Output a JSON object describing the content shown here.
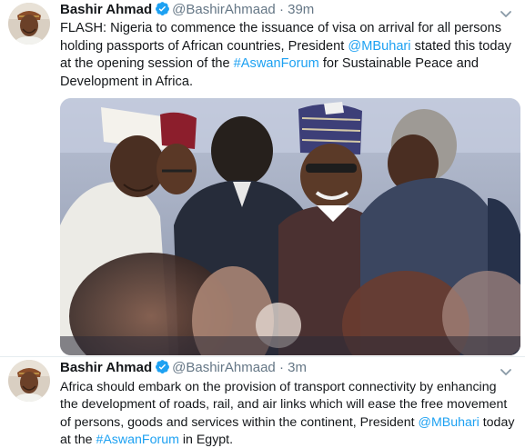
{
  "tweets": [
    {
      "author": {
        "name": "Bashir Ahmad",
        "handle": "@BashirAhmaad",
        "verified": true
      },
      "separator": "·",
      "time": "39m",
      "text": {
        "part1": "FLASH: Nigeria to commence the issuance of visa on arrival for all persons holding passports of African countries, President ",
        "mention": "@MBuhari",
        "part2": " stated this today at the opening session of the ",
        "hashtag": "#AswanForum",
        "part3": " for Sustainable Peace and Development in Africa."
      },
      "has_photo": true
    },
    {
      "author": {
        "name": "Bashir Ahmad",
        "handle": "@BashirAhmaad",
        "verified": true
      },
      "separator": "·",
      "time": "3m",
      "text": {
        "part1": "Africa should embark on the provision of transport connectivity by enhancing the development of roads, rail, and air links which will ease the free movement of persons, goods and services within the continent, President ",
        "mention": "@MBuhari",
        "part2": " today at the ",
        "hashtag": "#AswanForum",
        "part3": " in Egypt."
      }
    }
  ],
  "colors": {
    "link": "#1da1f2",
    "secondary": "#657786",
    "text": "#14171a"
  },
  "icons": [
    "avatar-photo",
    "verified-badge-icon",
    "chevron-down-icon"
  ]
}
